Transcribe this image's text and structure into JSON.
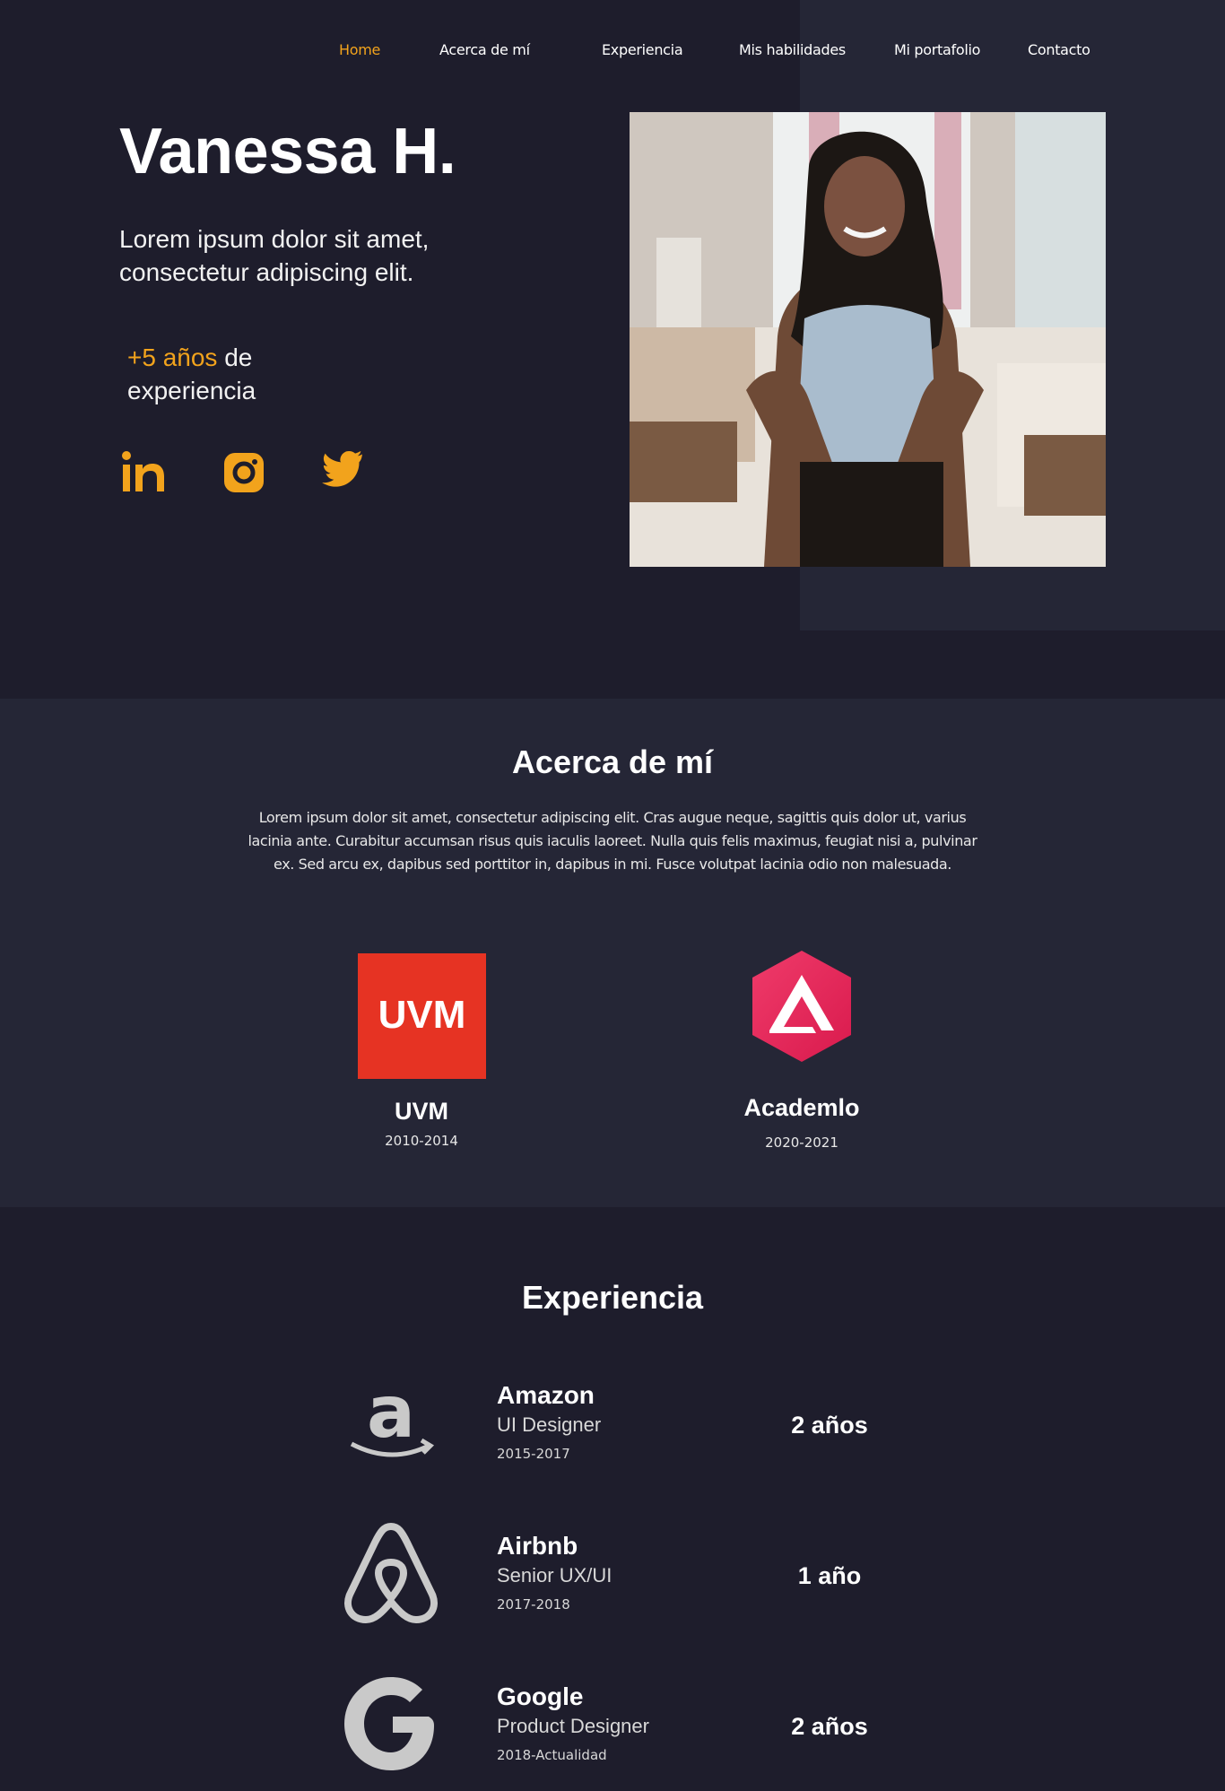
{
  "nav": {
    "items": [
      {
        "label": "Home",
        "active": true
      },
      {
        "label": "Acerca de mí",
        "active": false
      },
      {
        "label": "Experiencia",
        "active": false
      },
      {
        "label": "Mis habilidades",
        "active": false
      },
      {
        "label": "Mi portafolio",
        "active": false
      },
      {
        "label": "Contacto",
        "active": false
      }
    ]
  },
  "hero": {
    "name": "Vanessa H.",
    "tagline": "Lorem ipsum dolor sit amet, consectetur adipiscing elit.",
    "experience_highlight": "+5 años",
    "experience_rest": " de experiencia",
    "social": [
      "linkedin-icon",
      "instagram-icon",
      "twitter-icon"
    ],
    "accent_color": "#f2a31c"
  },
  "about": {
    "title": "Acerca de mí",
    "body": "Lorem ipsum dolor sit amet, consectetur adipiscing elit. Cras augue neque, sagittis quis dolor ut, varius lacinia ante. Curabitur accumsan risus quis iaculis laoreet. Nulla quis felis maximus, feugiat nisi a, pulvinar ex. Sed arcu ex, dapibus sed porttitor in, dapibus in mi. Fusce volutpat lacinia odio non malesuada.",
    "education": [
      {
        "name": "UVM",
        "years": "2010-2014",
        "logo_text": "UVM",
        "logo_color": "#e63323"
      },
      {
        "name": "Academlo",
        "years": "2020-2021",
        "logo_color": "#e8285a"
      }
    ]
  },
  "experience": {
    "title": "Experiencia",
    "jobs": [
      {
        "company": "Amazon",
        "role": "UI Designer",
        "years": "2015-2017",
        "duration": "2 años",
        "logo": "amazon-icon"
      },
      {
        "company": "Airbnb",
        "role": "Senior UX/UI",
        "years": "2017-2018",
        "duration": "1 año",
        "logo": "airbnb-icon"
      },
      {
        "company": "Google",
        "role": "Product Designer",
        "years": "2018-Actualidad",
        "duration": "2 años",
        "logo": "google-icon"
      }
    ]
  }
}
